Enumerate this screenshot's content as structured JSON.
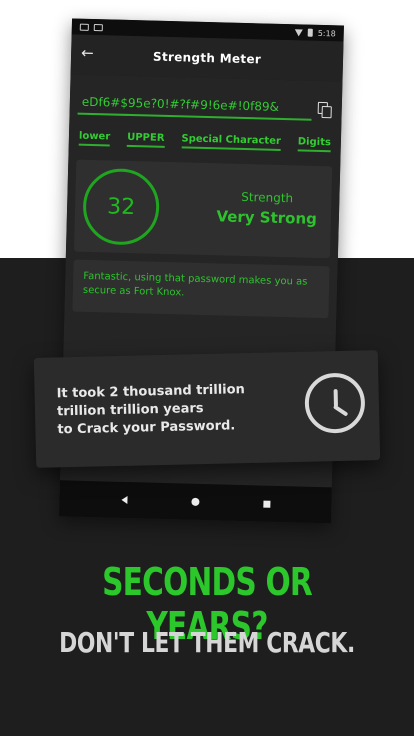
{
  "app": {
    "status_time": "5:18",
    "title": "Strength Meter",
    "password": "eDf6#$95e?0!#?f#9!6e#!0f89&",
    "chips": [
      "lower",
      "UPPER",
      "Special Character",
      "Digits"
    ],
    "score": "32",
    "strength_label": "Strength",
    "strength_value": "Very Strong",
    "message": "Fantastic, using that password makes you as secure as Fort Knox."
  },
  "time_card": {
    "text_line1": "It took 2 thousand  trillion",
    "text_line2": "trillion  trillion  years",
    "text_line3": "to Crack your Password."
  },
  "promo": {
    "headline": "SECONDS OR YEARS?",
    "subhead": "DON'T LET THEM CRACK."
  },
  "colors": {
    "accent_green": "#2bc72b",
    "dark_bg": "#1e1e1f"
  },
  "icons": [
    "back-arrow-icon",
    "copy-icon",
    "clock-icon"
  ]
}
